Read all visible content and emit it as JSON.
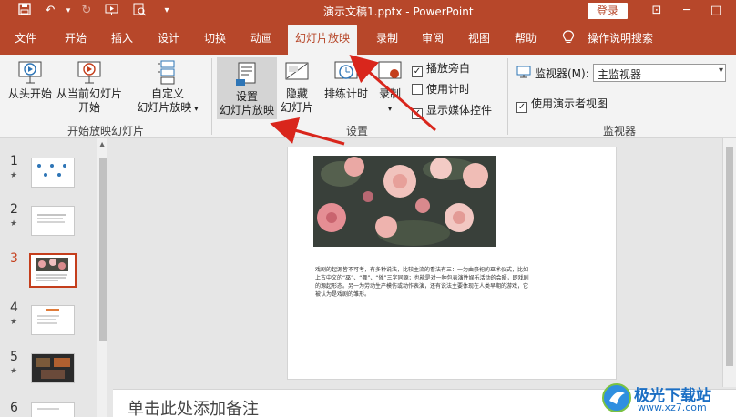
{
  "titlebar": {
    "doc_title": "演示文稿1.pptx  -  PowerPoint",
    "login_label": "登录",
    "qa_icons": [
      "save-icon",
      "undo-icon",
      "redo-icon",
      "slideshow-from-start-icon",
      "preview-icon",
      "customize-qa-icon"
    ]
  },
  "tabs": [
    "文件",
    "开始",
    "插入",
    "设计",
    "切换",
    "动画",
    "幻灯片放映",
    "录制",
    "审阅",
    "视图",
    "帮助"
  ],
  "active_tab": "幻灯片放映",
  "search_label": "操作说明搜索",
  "ribbon": {
    "from_start": "从头开始",
    "from_current_1": "从当前幻灯片",
    "from_current_2": "开始",
    "custom_1": "自定义",
    "custom_2": "幻灯片放映",
    "group_start": "开始放映幻灯片",
    "setup_1": "设置",
    "setup_2": "幻灯片放映",
    "hide_1": "隐藏",
    "hide_2": "幻灯片",
    "rehearse": "排练计时",
    "record": "录制",
    "chk_narration": "播放旁白",
    "chk_timing": "使用计时",
    "chk_media": "显示媒体控件",
    "group_setup": "设置",
    "monitor_label": "监视器(M):",
    "monitor_value": "主监视器",
    "presenter_view": "使用演示者视图",
    "group_monitor": "监视器"
  },
  "checks": {
    "narration": true,
    "timing": false,
    "media": true,
    "presenter": true
  },
  "slides": [
    "1",
    "2",
    "3",
    "4",
    "5",
    "6"
  ],
  "current_slide": "3",
  "slide_body": "戏剧的起源皆不可考，有多种说法，比较主流的看法有三：一为由祭祀的巫术仪式，比如上古中文的“巫”、“舞”、“傩”三字同源；也能是对一种包表演性娱乐活动的会晤，即戏剧的源起形态。另一为劳动生产模仿或动作表演，还有说法主要体现在人类早期的游戏，它被认为是戏剧的雏形。",
  "notes_placeholder": "单击此处添加备注",
  "watermark": {
    "line1": "极光下载站",
    "line2": "www.xz7.com"
  },
  "colors": {
    "brand": "#b7472a",
    "arrow": "#d9261c"
  }
}
